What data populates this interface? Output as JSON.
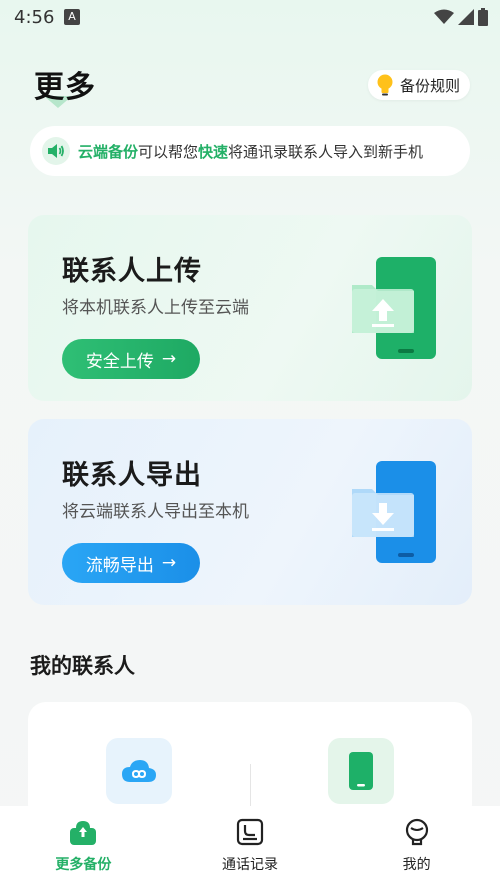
{
  "status": {
    "time": "4:56",
    "badge": "A"
  },
  "header": {
    "title": "更多",
    "rules_label": "备份规则"
  },
  "notice": {
    "part1": "云端备份",
    "part2": "可以帮您",
    "part3": "快速",
    "part4": "将通讯录联系人导入到新手机"
  },
  "cards": {
    "upload": {
      "title": "联系人上传",
      "subtitle": "将本机联系人上传至云端",
      "button": "安全上传",
      "arrow": "→"
    },
    "export": {
      "title": "联系人导出",
      "subtitle": "将云端联系人导出至本机",
      "button": "流畅导出",
      "arrow": "→"
    }
  },
  "my_contacts": {
    "title": "我的联系人"
  },
  "nav": {
    "items": [
      {
        "label": "更多备份",
        "icon": "cloud-box-icon",
        "active": true
      },
      {
        "label": "通话记录",
        "icon": "call-log-icon",
        "active": false
      },
      {
        "label": "我的",
        "icon": "profile-icon",
        "active": false
      }
    ]
  },
  "colors": {
    "accent_green": "#24b067",
    "accent_blue": "#1b8fe8"
  }
}
